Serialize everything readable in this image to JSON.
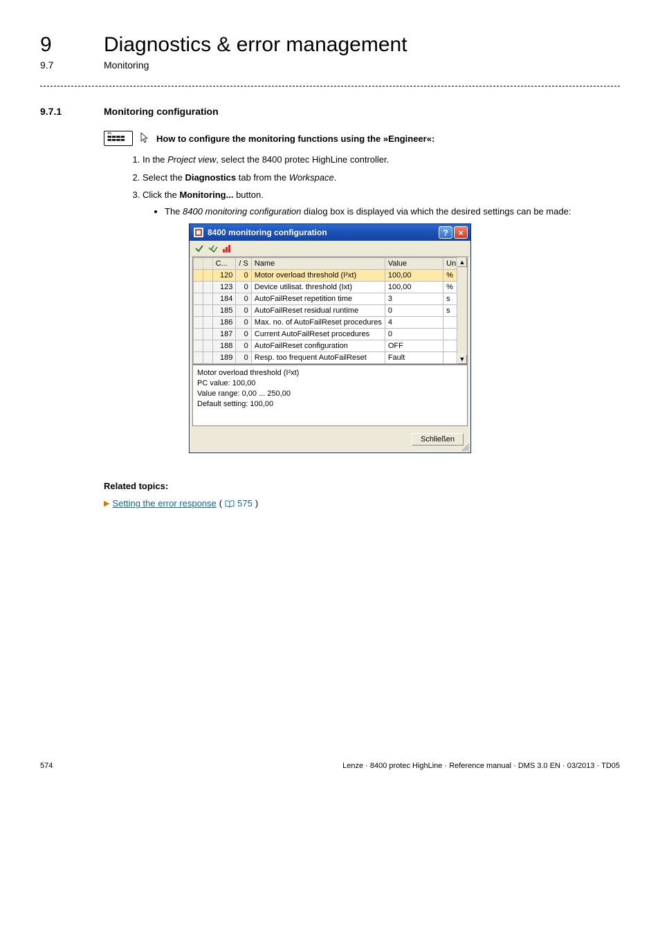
{
  "header": {
    "chapter_num": "9",
    "chapter_title": "Diagnostics & error management",
    "sub_num": "9.7",
    "sub_title": "Monitoring"
  },
  "section": {
    "num": "9.7.1",
    "title": "Monitoring configuration"
  },
  "howto": {
    "text": "How to configure the monitoring functions using the »Engineer«:"
  },
  "steps": {
    "s1_pre": "In the ",
    "s1_it": "Project view",
    "s1_post": ", select the 8400 protec HighLine controller.",
    "s2_pre": "Select the ",
    "s2_bd": "Diagnostics",
    "s2_mid": " tab from the ",
    "s2_it": "Workspace",
    "s2_post": ".",
    "s3_pre": "Click the ",
    "s3_bd": "Monitoring...",
    "s3_post": " button.",
    "s3b_pre": "The ",
    "s3b_it": "8400 monitoring configuration",
    "s3b_post": " dialog box is displayed via which the desired settings can be made:"
  },
  "dialog": {
    "title": "8400 monitoring configuration",
    "help_label": "?",
    "close_label": "×",
    "headers": {
      "flag": "",
      "c": "C...",
      "s": "/ S",
      "name": "Name",
      "value": "Value",
      "unit": "Unit"
    },
    "rows": [
      {
        "c": "120",
        "s": "0",
        "name": "Motor overload threshold (I²xt)",
        "value": "100,00",
        "unit": "%",
        "sel": true
      },
      {
        "c": "123",
        "s": "0",
        "name": "Device utilisat. threshold (Ixt)",
        "value": "100,00",
        "unit": "%",
        "sel": false
      },
      {
        "c": "184",
        "s": "0",
        "name": "AutoFailReset repetition time",
        "value": "3",
        "unit": "s",
        "sel": false
      },
      {
        "c": "185",
        "s": "0",
        "name": "AutoFailReset residual runtime",
        "value": "0",
        "unit": "s",
        "sel": false
      },
      {
        "c": "186",
        "s": "0",
        "name": "Max. no. of AutoFailReset procedures",
        "value": "4",
        "unit": "",
        "sel": false
      },
      {
        "c": "187",
        "s": "0",
        "name": "Current AutoFailReset procedures",
        "value": "0",
        "unit": "",
        "sel": false
      },
      {
        "c": "188",
        "s": "0",
        "name": "AutoFailReset configuration",
        "value": "OFF",
        "unit": "",
        "sel": false
      },
      {
        "c": "189",
        "s": "0",
        "name": "Resp. too frequent AutoFailReset",
        "value": "Fault",
        "unit": "",
        "sel": false
      }
    ],
    "desc": {
      "l1": "Motor overload threshold (I²xt)",
      "l2": "PC value: 100,00",
      "l3": "Value range: 0,00 ... 250,00",
      "l4": "Default setting: 100,00"
    },
    "close_button": "Schließen",
    "scroll_up": "▲",
    "scroll_down": "▼"
  },
  "related": {
    "heading": "Related topics:",
    "link_text": "Setting the error response",
    "page_ref": "575"
  },
  "footer": {
    "page": "574",
    "meta": "Lenze · 8400 protec HighLine · Reference manual · DMS 3.0 EN · 03/2013 · TD05"
  }
}
